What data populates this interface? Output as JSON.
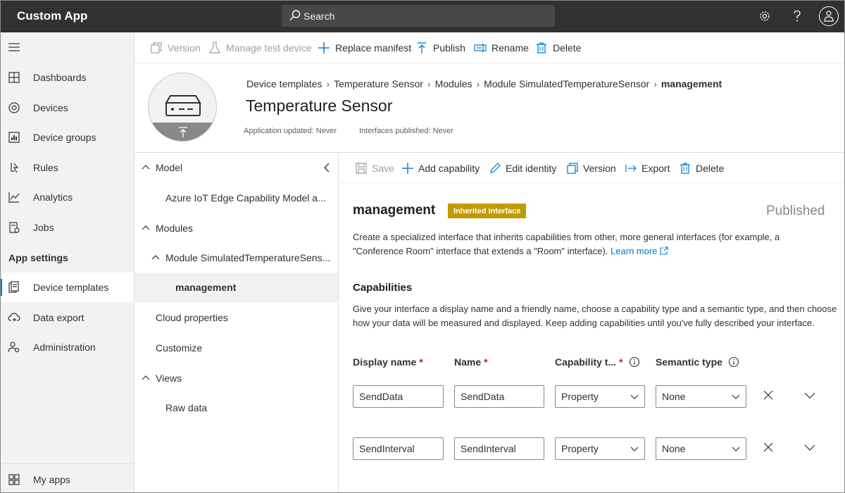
{
  "app": {
    "title": "Custom App"
  },
  "search": {
    "placeholder": "Search"
  },
  "nav": {
    "items": [
      {
        "label": "Dashboards",
        "icon": "dashboard-icon"
      },
      {
        "label": "Devices",
        "icon": "devices-icon"
      },
      {
        "label": "Device groups",
        "icon": "device-groups-icon"
      },
      {
        "label": "Rules",
        "icon": "rules-icon"
      },
      {
        "label": "Analytics",
        "icon": "analytics-icon"
      },
      {
        "label": "Jobs",
        "icon": "jobs-icon"
      }
    ],
    "section": "App settings",
    "settings_items": [
      {
        "label": "Device templates",
        "icon": "device-templates-icon",
        "active": true
      },
      {
        "label": "Data export",
        "icon": "data-export-icon"
      },
      {
        "label": "Administration",
        "icon": "administration-icon"
      }
    ],
    "bottom": {
      "label": "My apps",
      "icon": "my-apps-icon"
    }
  },
  "toolbar": {
    "version": "Version",
    "manage_test_device": "Manage test device",
    "replace_manifest": "Replace manifest",
    "publish": "Publish",
    "rename": "Rename",
    "delete": "Delete"
  },
  "header": {
    "breadcrumb": [
      "Device templates",
      "Temperature Sensor",
      "Modules",
      "Module SimulatedTemperatureSensor",
      "management"
    ],
    "title": "Temperature Sensor",
    "app_updated": "Application updated: Never",
    "interfaces_published": "Interfaces published: Never"
  },
  "tree": {
    "items": [
      {
        "label": "Model"
      },
      {
        "label": "Azure IoT Edge Capability Model a..."
      },
      {
        "label": "Modules"
      },
      {
        "label": "Module SimulatedTemperatureSens..."
      },
      {
        "label": "management"
      },
      {
        "label": "Cloud properties"
      },
      {
        "label": "Customize"
      },
      {
        "label": "Views"
      },
      {
        "label": "Raw data"
      }
    ]
  },
  "subtoolbar": {
    "save": "Save",
    "add_capability": "Add capability",
    "edit_identity": "Edit identity",
    "version": "Version",
    "export": "Export",
    "delete": "Delete"
  },
  "interface": {
    "name": "management",
    "badge": "Inherited interface",
    "status": "Published",
    "description": "Create a specialized interface that inherits capabilities from other, more general interfaces (for example, a \"Conference Room\" interface that extends a \"Room\" interface).",
    "learn_more": "Learn more"
  },
  "capabilities": {
    "title": "Capabilities",
    "description": "Give your interface a display name and a friendly name, choose a capability type and a semantic type, and then choose how your data will be measured and displayed. Keep adding capabilities until you've fully described your interface.",
    "columns": {
      "display_name": "Display name",
      "name": "Name",
      "capability_type": "Capability t...",
      "semantic_type": "Semantic type",
      "required_mark": "*"
    },
    "rows": [
      {
        "display_name": "SendData",
        "name": "SendData",
        "capability_type": "Property",
        "semantic_type": "None"
      },
      {
        "display_name": "SendInterval",
        "name": "SendInterval",
        "capability_type": "Property",
        "semantic_type": "None"
      }
    ]
  },
  "colors": {
    "topbar": "#323130",
    "accent": "#0078d4",
    "badge": "#c19c00"
  }
}
